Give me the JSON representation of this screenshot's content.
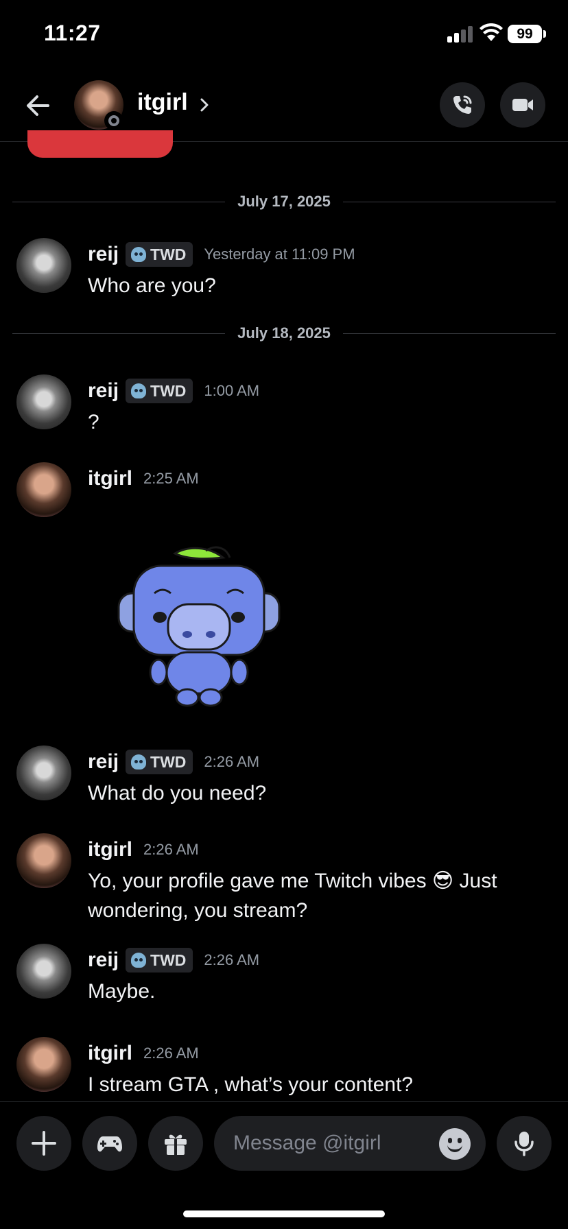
{
  "status_bar": {
    "time": "11:27",
    "battery": "99"
  },
  "header": {
    "title": "itgirl"
  },
  "dividers": [
    "July 17, 2025",
    "July 18, 2025"
  ],
  "messages": [
    {
      "author": "reij",
      "tag": "TWD",
      "time": "Yesterday at 11:09 PM",
      "text": "Who are you?"
    },
    {
      "author": "reij",
      "tag": "TWD",
      "time": "1:00 AM",
      "text": "?"
    },
    {
      "author": "itgirl",
      "time": "2:25 AM",
      "text": ""
    },
    {
      "author": "reij",
      "tag": "TWD",
      "time": "2:26 AM",
      "text": "What do you need?"
    },
    {
      "author": "itgirl",
      "time": "2:26 AM",
      "text": "Yo, your profile gave me Twitch vibes 😎 Just wondering, you stream?"
    },
    {
      "author": "reij",
      "tag": "TWD",
      "time": "2:26 AM",
      "text": "Maybe."
    },
    {
      "author": "itgirl",
      "time": "2:26 AM",
      "text": "I stream GTA , what’s your content?"
    }
  ],
  "composer": {
    "placeholder": "Message @itgirl"
  },
  "colors": {
    "background": "#000000",
    "pill_red": "#da373c",
    "surface": "#1e1f22",
    "muted_text": "#949ba4"
  },
  "icons": [
    "back-arrow-icon",
    "chevron-right-icon",
    "phone-call-icon",
    "video-camera-icon",
    "plus-icon",
    "gamepad-icon",
    "gift-icon",
    "emoji-icon",
    "microphone-icon",
    "skull-icon"
  ]
}
